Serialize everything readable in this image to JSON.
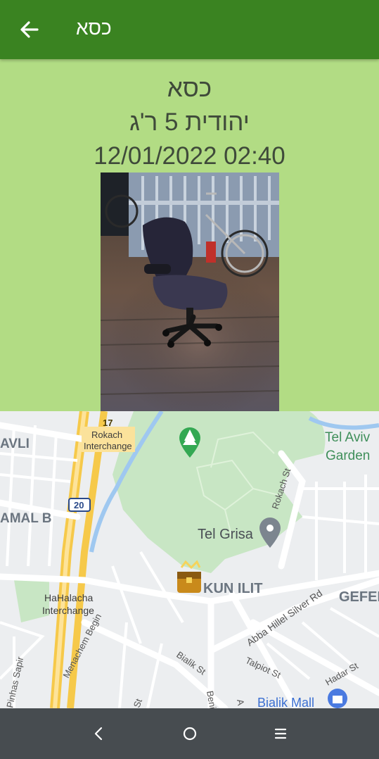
{
  "app_bar": {
    "title": "כסא",
    "back_icon": "arrow-left-icon",
    "background": "#3a8321"
  },
  "item": {
    "name": "כסא",
    "address": "יהודית 5 ר'ג",
    "datetime": "12/01/2022 02:40",
    "photo_description_icon": "office-chair-photo"
  },
  "map": {
    "labels": {
      "route_number": "17",
      "rokach_interchange": "Rokach\nInterchange",
      "ramal_b": "AMAL B",
      "avli": "AVLI",
      "route_20": "20",
      "tel_aviv_garden": "Tel Aviv\nGarden",
      "rokach_st": "Rokach St",
      "tel_grisa": "Tel Grisa",
      "kun_ilit": "KUN ILIT",
      "gefen": "GEFEN",
      "abba_hillel": "Abba Hillel Silver Rd",
      "hahalacha_interchange": "HaHalacha\nInterchange",
      "menachem_begin": "Menachem Begin",
      "bialik_st": "Bialik St",
      "talpiot_st": "Talpiot St",
      "hadar_st": "Hadar St",
      "bialik_mall": "Bialik Mall",
      "pinhas_sapir": "Pinhas Sapir",
      "st": "St",
      "beni": "Beni",
      "a": "A"
    },
    "colors": {
      "park": "#c8e6c4",
      "road": "#ffffff",
      "highway": "#f9d46b",
      "water": "#9fc8f0",
      "base": "#eceef0"
    }
  },
  "nav_bar": {
    "back_icon": "nav-back-icon",
    "home_icon": "nav-home-icon",
    "recents_icon": "nav-recents-icon"
  }
}
